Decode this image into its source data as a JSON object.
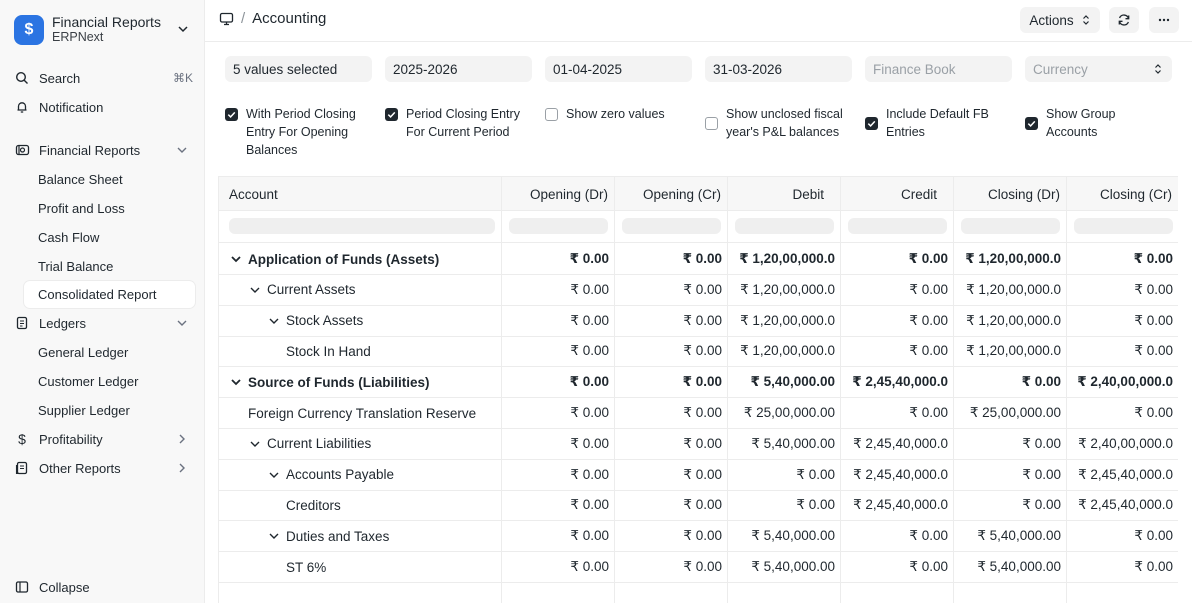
{
  "app": {
    "title": "Financial Reports",
    "subtitle": "ERPNext",
    "logo_glyph": "$"
  },
  "sidebar": {
    "search_label": "Search",
    "search_shortcut": "⌘K",
    "notification_label": "Notification",
    "groups": [
      {
        "label": "Financial Reports",
        "icon": "report-icon",
        "expanded": true,
        "items": [
          "Balance Sheet",
          "Profit and Loss",
          "Cash Flow",
          "Trial Balance",
          "Consolidated Report"
        ]
      },
      {
        "label": "Ledgers",
        "icon": "ledger-icon",
        "expanded": true,
        "items": [
          "General Ledger",
          "Customer Ledger",
          "Supplier Ledger"
        ]
      },
      {
        "label": "Profitability",
        "icon": "dollar-icon",
        "expanded": false,
        "items": []
      },
      {
        "label": "Other Reports",
        "icon": "document-icon",
        "expanded": false,
        "items": []
      }
    ],
    "active_item": "Consolidated Report",
    "collapse_label": "Collapse"
  },
  "topbar": {
    "page_title": "Accounting",
    "separator": "/",
    "actions_label": "Actions"
  },
  "filters": {
    "company": "5 values selected",
    "fiscal_year": "2025-2026",
    "from_date": "01-04-2025",
    "to_date": "31-03-2026",
    "finance_book_placeholder": "Finance Book",
    "currency_placeholder": "Currency"
  },
  "checkboxes": [
    {
      "lines": [
        "With Period Closing",
        "Entry For Opening",
        "Balances"
      ],
      "checked": true
    },
    {
      "lines": [
        "Period Closing Entry",
        "For Current Period"
      ],
      "checked": true
    },
    {
      "lines": [
        "Show zero values"
      ],
      "checked": false
    },
    {
      "lines": [
        "Show unclosed fiscal",
        "year's P&L balances"
      ],
      "checked": false
    },
    {
      "lines": [
        "Include Default FB",
        "Entries"
      ],
      "checked": true
    },
    {
      "lines": [
        "Show Group",
        "Accounts"
      ],
      "checked": true
    }
  ],
  "table": {
    "columns": [
      "Account",
      "Opening (Dr)",
      "Opening (Cr)",
      "Debit",
      "Credit",
      "Closing (Dr)",
      "Closing (Cr)"
    ],
    "rows": [
      {
        "account": "Application of Funds (Assets)",
        "level": 0,
        "toggle": true,
        "bold": true,
        "values": [
          "₹ 0.00",
          "₹ 0.00",
          "₹ 1,20,00,000.0",
          "₹ 0.00",
          "₹ 1,20,00,000.0",
          "₹ 0.00"
        ]
      },
      {
        "account": "Current Assets",
        "level": 1,
        "toggle": true,
        "bold": false,
        "values": [
          "₹ 0.00",
          "₹ 0.00",
          "₹ 1,20,00,000.0",
          "₹ 0.00",
          "₹ 1,20,00,000.0",
          "₹ 0.00"
        ]
      },
      {
        "account": "Stock Assets",
        "level": 2,
        "toggle": true,
        "bold": false,
        "values": [
          "₹ 0.00",
          "₹ 0.00",
          "₹ 1,20,00,000.0",
          "₹ 0.00",
          "₹ 1,20,00,000.0",
          "₹ 0.00"
        ]
      },
      {
        "account": "Stock In Hand",
        "level": 3,
        "toggle": false,
        "bold": false,
        "values": [
          "₹ 0.00",
          "₹ 0.00",
          "₹ 1,20,00,000.0",
          "₹ 0.00",
          "₹ 1,20,00,000.0",
          "₹ 0.00"
        ]
      },
      {
        "account": "Source of Funds (Liabilities)",
        "level": 0,
        "toggle": true,
        "bold": true,
        "values": [
          "₹ 0.00",
          "₹ 0.00",
          "₹ 5,40,000.00",
          "₹ 2,45,40,000.0",
          "₹ 0.00",
          "₹ 2,40,00,000.0"
        ]
      },
      {
        "account": "Foreign Currency Translation Reserve",
        "level": 1,
        "toggle": false,
        "bold": false,
        "values": [
          "₹ 0.00",
          "₹ 0.00",
          "₹ 25,00,000.00",
          "₹ 0.00",
          "₹ 25,00,000.00",
          "₹ 0.00"
        ]
      },
      {
        "account": "Current Liabilities",
        "level": 1,
        "toggle": true,
        "bold": false,
        "values": [
          "₹ 0.00",
          "₹ 0.00",
          "₹ 5,40,000.00",
          "₹ 2,45,40,000.0",
          "₹ 0.00",
          "₹ 2,40,00,000.0"
        ]
      },
      {
        "account": "Accounts Payable",
        "level": 2,
        "toggle": true,
        "bold": false,
        "values": [
          "₹ 0.00",
          "₹ 0.00",
          "₹ 0.00",
          "₹ 2,45,40,000.0",
          "₹ 0.00",
          "₹ 2,45,40,000.0"
        ]
      },
      {
        "account": "Creditors",
        "level": 3,
        "toggle": false,
        "bold": false,
        "values": [
          "₹ 0.00",
          "₹ 0.00",
          "₹ 0.00",
          "₹ 2,45,40,000.0",
          "₹ 0.00",
          "₹ 2,45,40,000.0"
        ]
      },
      {
        "account": "Duties and Taxes",
        "level": 2,
        "toggle": true,
        "bold": false,
        "values": [
          "₹ 0.00",
          "₹ 0.00",
          "₹ 5,40,000.00",
          "₹ 0.00",
          "₹ 5,40,000.00",
          "₹ 0.00"
        ]
      },
      {
        "account": "ST 6%",
        "level": 3,
        "toggle": false,
        "bold": false,
        "values": [
          "₹ 0.00",
          "₹ 0.00",
          "₹ 5,40,000.00",
          "₹ 0.00",
          "₹ 5,40,000.00",
          "₹ 0.00"
        ]
      }
    ]
  }
}
